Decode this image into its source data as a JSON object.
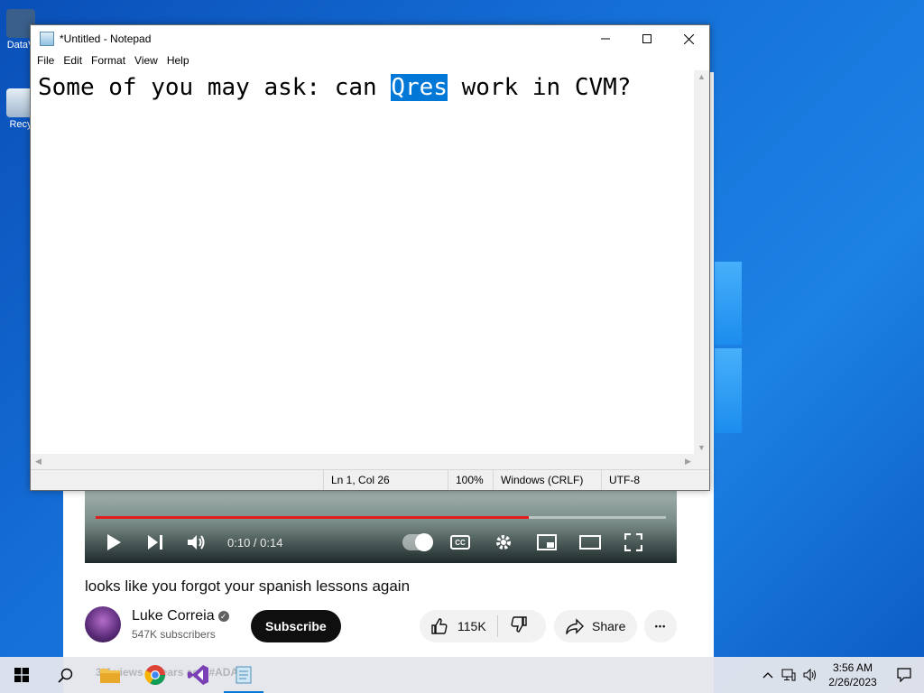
{
  "desktop": {
    "icons": [
      {
        "label": "DataV"
      },
      {
        "label": "Recy"
      }
    ]
  },
  "browser": {
    "video": {
      "time_display": "0:10 / 0:14",
      "progress_fraction": 0.76
    },
    "video_title": "looks like you forgot your spanish lessons again",
    "channel": {
      "name": "Luke Correia",
      "verified_glyph": "✓",
      "subscribers": "547K subscribers",
      "subscribe_label": "Subscribe"
    },
    "actions": {
      "like_count": "115K",
      "share_label": "Share",
      "more_glyph": "•••"
    },
    "faded_text": "3M views  2 years ago  #ADA"
  },
  "notepad": {
    "title": "*Untitled - Notepad",
    "menu": [
      "File",
      "Edit",
      "Format",
      "View",
      "Help"
    ],
    "text_before": "Some of you may ask: can ",
    "text_selected": "Qres",
    "text_after": " work in CVM?",
    "status": {
      "position": "Ln 1, Col 26",
      "zoom": "100%",
      "line_ending": "Windows (CRLF)",
      "encoding": "UTF-8"
    }
  },
  "taskbar": {
    "time": "3:56 AM",
    "date": "2/26/2023",
    "apps": [
      "start-icon",
      "search-icon",
      "file-explorer-icon",
      "chrome-icon",
      "visual-studio-icon",
      "notepad-icon"
    ]
  },
  "colors": {
    "selection": "#0078d7",
    "progress": "#e01e1e",
    "desktop": "#1570d8"
  }
}
